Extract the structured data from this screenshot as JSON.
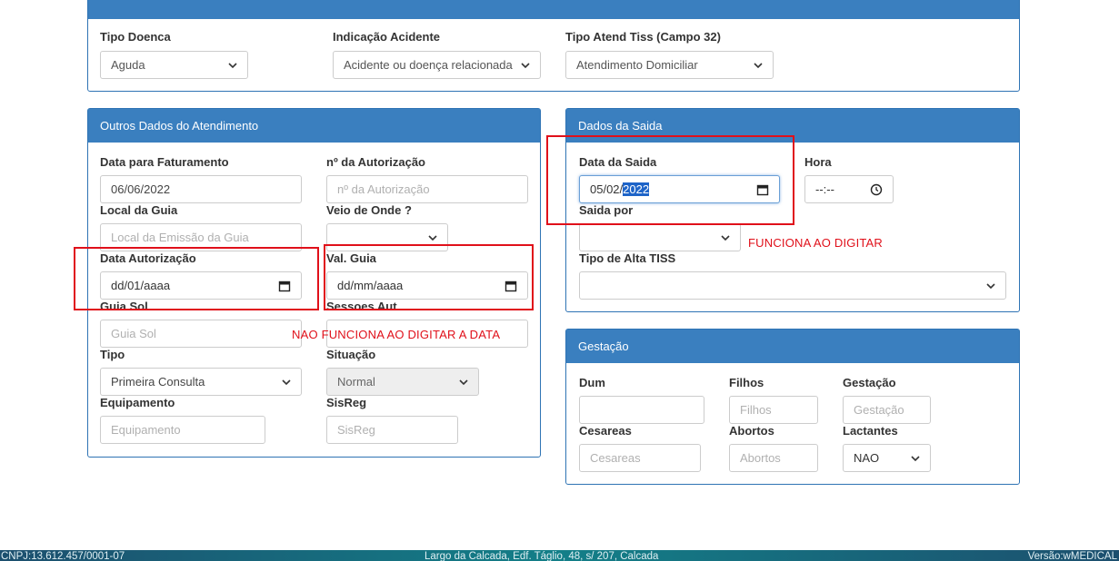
{
  "top_panel": {
    "tipo_doenca": {
      "label": "Tipo Doenca",
      "value": "Aguda"
    },
    "indicacao_acidente": {
      "label": "Indicação Acidente",
      "value": "Acidente ou doença relacionada a"
    },
    "tipo_atend_tiss": {
      "label": "Tipo Atend Tiss (Campo 32)",
      "value": "Atendimento Domiciliar"
    }
  },
  "outros": {
    "title": "Outros Dados do Atendimento",
    "data_faturamento": {
      "label": "Data para Faturamento",
      "value": "06/06/2022"
    },
    "n_autorizacao": {
      "label": "nº da Autorização",
      "placeholder": "nº da Autorização"
    },
    "local_guia": {
      "label": "Local da Guia",
      "placeholder": "Local da Emissão da Guia"
    },
    "veio_de_onde": {
      "label": "Veio de Onde ?",
      "value": ""
    },
    "data_autorizacao": {
      "label": "Data Autorização",
      "value": "dd/01/aaaa"
    },
    "val_guia": {
      "label": "Val. Guia",
      "value": "dd/mm/aaaa"
    },
    "guia_sol": {
      "label": "Guia Sol",
      "placeholder": "Guia Sol"
    },
    "sessoes_aut": {
      "label": "Sessoes Aut"
    },
    "tipo": {
      "label": "Tipo",
      "value": "Primeira Consulta"
    },
    "situacao": {
      "label": "Situação",
      "value": "Normal"
    },
    "equipamento": {
      "label": "Equipamento",
      "placeholder": "Equipamento"
    },
    "sisreg": {
      "label": "SisReg",
      "placeholder": "SisReg"
    }
  },
  "saida": {
    "title": "Dados da Saida",
    "data_saida": {
      "label": "Data da Saida",
      "value_prefix": "05/02/",
      "value_selected": "2022"
    },
    "hora": {
      "label": "Hora",
      "value": "--:--"
    },
    "saida_por": {
      "label": "Saida por",
      "value": ""
    },
    "tipo_alta": {
      "label": "Tipo de Alta TISS",
      "value": ""
    }
  },
  "gestacao": {
    "title": "Gestação",
    "dum": {
      "label": "Dum"
    },
    "filhos": {
      "label": "Filhos",
      "placeholder": "Filhos"
    },
    "gestacao": {
      "label": "Gestação",
      "placeholder": "Gestação"
    },
    "cesareas": {
      "label": "Cesareas",
      "placeholder": "Cesareas"
    },
    "abortos": {
      "label": "Abortos",
      "placeholder": "Abortos"
    },
    "lactantes": {
      "label": "Lactantes",
      "value": "NAO"
    }
  },
  "annotations": {
    "works": "FUNCIONA AO DIGITAR",
    "not_works": "NAO FUNCIONA AO DIGITAR A DATA"
  },
  "footer": {
    "cnpj": "CNPJ:13.612.457/0001-07",
    "address": "Largo da Calcada, Edf. Táglio, 48, s/ 207, Calcada",
    "version": "Versão:wMEDICAL"
  }
}
